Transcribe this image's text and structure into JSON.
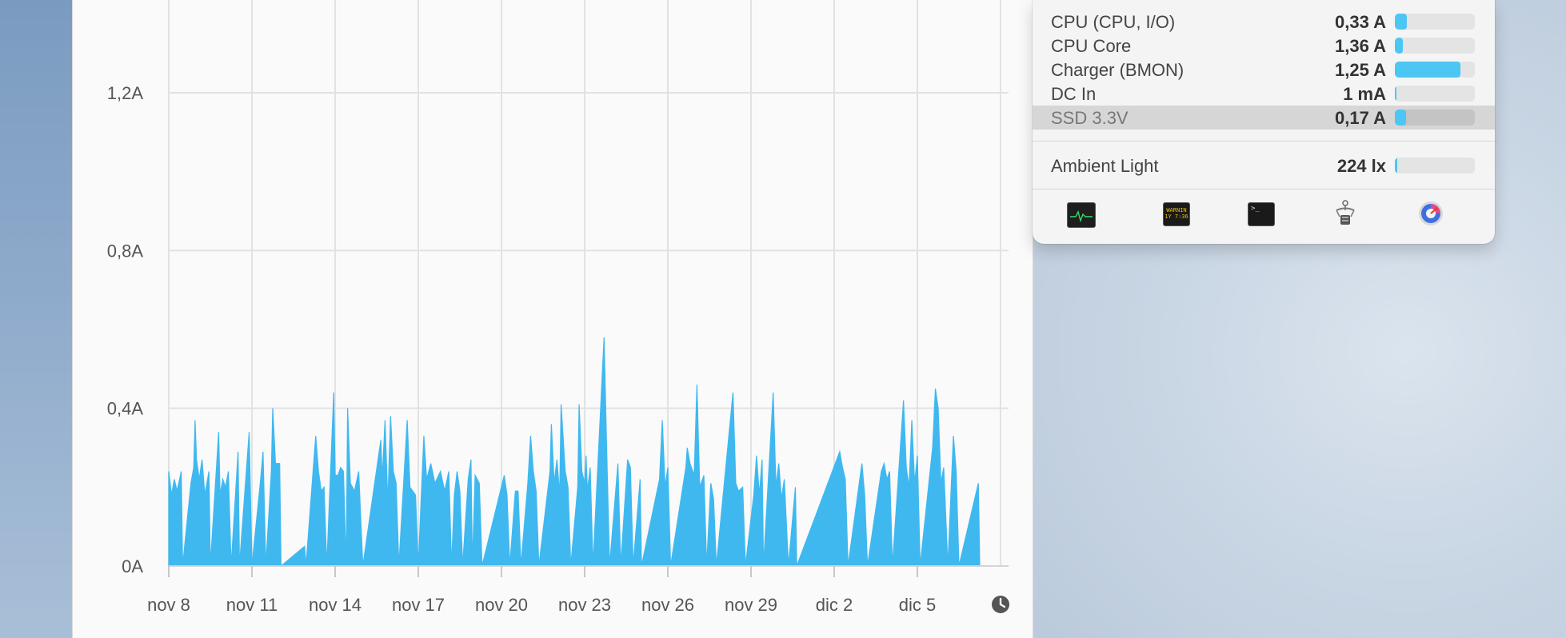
{
  "chart_data": {
    "type": "area",
    "ylabels": [
      "1,2A",
      "0,8A",
      "0,4A",
      "0A"
    ],
    "yticks": [
      1.2,
      0.8,
      0.4,
      0
    ],
    "ylim": [
      0,
      1.4
    ],
    "xlabels": [
      "nov 8",
      "nov 11",
      "nov 14",
      "nov 17",
      "nov 20",
      "nov 23",
      "nov 26",
      "nov 29",
      "dic 2",
      "dic 5"
    ],
    "x_start_label": "nov 8",
    "days_span": 30,
    "grid": true,
    "color": "#3fb8f0",
    "series": [
      {
        "values": [
          [
            0.0,
            0.24
          ],
          [
            0.1,
            0.18
          ],
          [
            0.2,
            0.22
          ],
          [
            0.3,
            0.19
          ],
          [
            0.45,
            0.24
          ],
          [
            0.5,
            0
          ],
          [
            0.8,
            0.21
          ],
          [
            0.9,
            0.25
          ],
          [
            0.95,
            0.37
          ],
          [
            1.0,
            0.27
          ],
          [
            1.1,
            0.22
          ],
          [
            1.2,
            0.27
          ],
          [
            1.3,
            0.18
          ],
          [
            1.45,
            0.24
          ],
          [
            1.5,
            0
          ],
          [
            1.8,
            0.34
          ],
          [
            1.85,
            0.18
          ],
          [
            1.95,
            0.22
          ],
          [
            2.05,
            0.2
          ],
          [
            2.15,
            0.24
          ],
          [
            2.25,
            0
          ],
          [
            2.5,
            0.29
          ],
          [
            2.55,
            0
          ],
          [
            2.9,
            0.34
          ],
          [
            2.95,
            0.17
          ],
          [
            3.0,
            0
          ],
          [
            3.3,
            0.21
          ],
          [
            3.4,
            0.29
          ],
          [
            3.5,
            0
          ],
          [
            3.7,
            0.24
          ],
          [
            3.75,
            0.4
          ],
          [
            3.85,
            0.26
          ],
          [
            4.0,
            0.26
          ],
          [
            4.05,
            0
          ],
          [
            4.9,
            0.05
          ],
          [
            4.95,
            0
          ],
          [
            5.3,
            0.33
          ],
          [
            5.4,
            0.24
          ],
          [
            5.5,
            0.19
          ],
          [
            5.6,
            0.2
          ],
          [
            5.7,
            0
          ],
          [
            5.95,
            0.44
          ],
          [
            6.0,
            0.23
          ],
          [
            6.1,
            0.23
          ],
          [
            6.2,
            0.25
          ],
          [
            6.3,
            0.24
          ],
          [
            6.4,
            0
          ],
          [
            6.45,
            0.4
          ],
          [
            6.55,
            0.21
          ],
          [
            6.7,
            0.19
          ],
          [
            6.85,
            0.24
          ],
          [
            7.0,
            0
          ],
          [
            7.65,
            0.32
          ],
          [
            7.7,
            0.22
          ],
          [
            7.8,
            0.37
          ],
          [
            7.9,
            0.16
          ],
          [
            8.0,
            0.38
          ],
          [
            8.1,
            0.24
          ],
          [
            8.2,
            0.21
          ],
          [
            8.3,
            0
          ],
          [
            8.6,
            0.37
          ],
          [
            8.7,
            0.2
          ],
          [
            8.8,
            0.19
          ],
          [
            8.9,
            0.18
          ],
          [
            9.0,
            0
          ],
          [
            9.2,
            0.33
          ],
          [
            9.3,
            0.22
          ],
          [
            9.45,
            0.26
          ],
          [
            9.6,
            0.21
          ],
          [
            9.8,
            0.24
          ],
          [
            9.95,
            0.19
          ],
          [
            10.1,
            0.24
          ],
          [
            10.2,
            0
          ],
          [
            10.3,
            0.18
          ],
          [
            10.4,
            0.24
          ],
          [
            10.5,
            0.19
          ],
          [
            10.6,
            0
          ],
          [
            10.8,
            0.22
          ],
          [
            10.9,
            0.27
          ],
          [
            10.95,
            0
          ],
          [
            11.05,
            0.23
          ],
          [
            11.2,
            0.21
          ],
          [
            11.3,
            0
          ],
          [
            12.1,
            0.23
          ],
          [
            12.2,
            0.18
          ],
          [
            12.3,
            0
          ],
          [
            12.5,
            0.19
          ],
          [
            12.6,
            0.19
          ],
          [
            12.7,
            0
          ],
          [
            12.95,
            0.21
          ],
          [
            13.05,
            0.33
          ],
          [
            13.15,
            0.24
          ],
          [
            13.25,
            0.19
          ],
          [
            13.35,
            0
          ],
          [
            13.75,
            0.24
          ],
          [
            13.8,
            0.36
          ],
          [
            13.9,
            0.21
          ],
          [
            14.0,
            0.27
          ],
          [
            14.1,
            0.18
          ],
          [
            14.15,
            0.41
          ],
          [
            14.3,
            0.24
          ],
          [
            14.4,
            0.2
          ],
          [
            14.5,
            0
          ],
          [
            14.75,
            0.2
          ],
          [
            14.8,
            0.41
          ],
          [
            14.9,
            0.24
          ],
          [
            15.0,
            0.21
          ],
          [
            15.05,
            0.28
          ],
          [
            15.1,
            0.19
          ],
          [
            15.2,
            0.25
          ],
          [
            15.3,
            0
          ],
          [
            15.7,
            0.58
          ],
          [
            15.8,
            0.28
          ],
          [
            15.9,
            0
          ],
          [
            16.2,
            0.26
          ],
          [
            16.3,
            0
          ],
          [
            16.55,
            0.27
          ],
          [
            16.65,
            0.25
          ],
          [
            16.75,
            0
          ],
          [
            17.0,
            0.22
          ],
          [
            17.05,
            0
          ],
          [
            17.7,
            0.22
          ],
          [
            17.8,
            0.37
          ],
          [
            17.9,
            0.2
          ],
          [
            18.0,
            0.25
          ],
          [
            18.1,
            0
          ],
          [
            18.65,
            0.25
          ],
          [
            18.7,
            0.3
          ],
          [
            18.8,
            0.26
          ],
          [
            18.95,
            0.23
          ],
          [
            19.05,
            0.46
          ],
          [
            19.15,
            0.2
          ],
          [
            19.3,
            0.23
          ],
          [
            19.4,
            0
          ],
          [
            19.55,
            0.21
          ],
          [
            19.65,
            0.17
          ],
          [
            19.75,
            0
          ],
          [
            20.35,
            0.44
          ],
          [
            20.45,
            0.21
          ],
          [
            20.55,
            0.19
          ],
          [
            20.7,
            0.2
          ],
          [
            20.8,
            0
          ],
          [
            21.1,
            0.18
          ],
          [
            21.2,
            0.28
          ],
          [
            21.3,
            0.18
          ],
          [
            21.4,
            0.27
          ],
          [
            21.45,
            0
          ],
          [
            21.8,
            0.44
          ],
          [
            21.9,
            0.2
          ],
          [
            22.0,
            0.26
          ],
          [
            22.1,
            0.17
          ],
          [
            22.2,
            0.22
          ],
          [
            22.35,
            0
          ],
          [
            22.6,
            0.2
          ],
          [
            22.65,
            0
          ],
          [
            24.2,
            0.29
          ],
          [
            24.3,
            0.25
          ],
          [
            24.4,
            0.22
          ],
          [
            24.5,
            0
          ],
          [
            25.0,
            0.26
          ],
          [
            25.1,
            0.18
          ],
          [
            25.2,
            0
          ],
          [
            25.7,
            0.24
          ],
          [
            25.8,
            0.26
          ],
          [
            25.9,
            0.22
          ],
          [
            26.0,
            0.24
          ],
          [
            26.1,
            0
          ],
          [
            26.5,
            0.42
          ],
          [
            26.6,
            0.25
          ],
          [
            26.7,
            0.2
          ],
          [
            26.8,
            0.37
          ],
          [
            26.9,
            0.21
          ],
          [
            27.0,
            0.28
          ],
          [
            27.1,
            0
          ],
          [
            27.55,
            0.3
          ],
          [
            27.65,
            0.45
          ],
          [
            27.75,
            0.4
          ],
          [
            27.85,
            0.21
          ],
          [
            27.95,
            0.25
          ],
          [
            28.1,
            0
          ],
          [
            28.3,
            0.33
          ],
          [
            28.4,
            0.24
          ],
          [
            28.5,
            0
          ],
          [
            29.2,
            0.21
          ],
          [
            29.25,
            0
          ]
        ]
      }
    ]
  },
  "chart": {
    "clock_icon": "clock-icon"
  },
  "panel": {
    "rows": [
      {
        "label": "CPU (CPU, I/O)",
        "value": "0,33 A",
        "level": 0.15,
        "highlighted": false
      },
      {
        "label": "CPU Core",
        "value": "1,36 A",
        "level": 0.1,
        "highlighted": false
      },
      {
        "label": "Charger (BMON)",
        "value": "1,25 A",
        "level": 0.82,
        "highlighted": false
      },
      {
        "label": "DC In",
        "value": "1 mA",
        "level": 0.02,
        "highlighted": false
      },
      {
        "label": "SSD 3.3V",
        "value": "0,17 A",
        "level": 0.14,
        "highlighted": true
      }
    ],
    "ambient": {
      "label": "Ambient Light",
      "value": "224 lx",
      "level": 0.03
    },
    "toolbar": [
      {
        "name": "activity-monitor-icon"
      },
      {
        "name": "console-icon",
        "text1": "WARNIN",
        "text2": "1Y 7:36"
      },
      {
        "name": "terminal-icon",
        "text": ">_"
      },
      {
        "name": "system-information-icon"
      },
      {
        "name": "istat-menus-icon"
      }
    ]
  }
}
